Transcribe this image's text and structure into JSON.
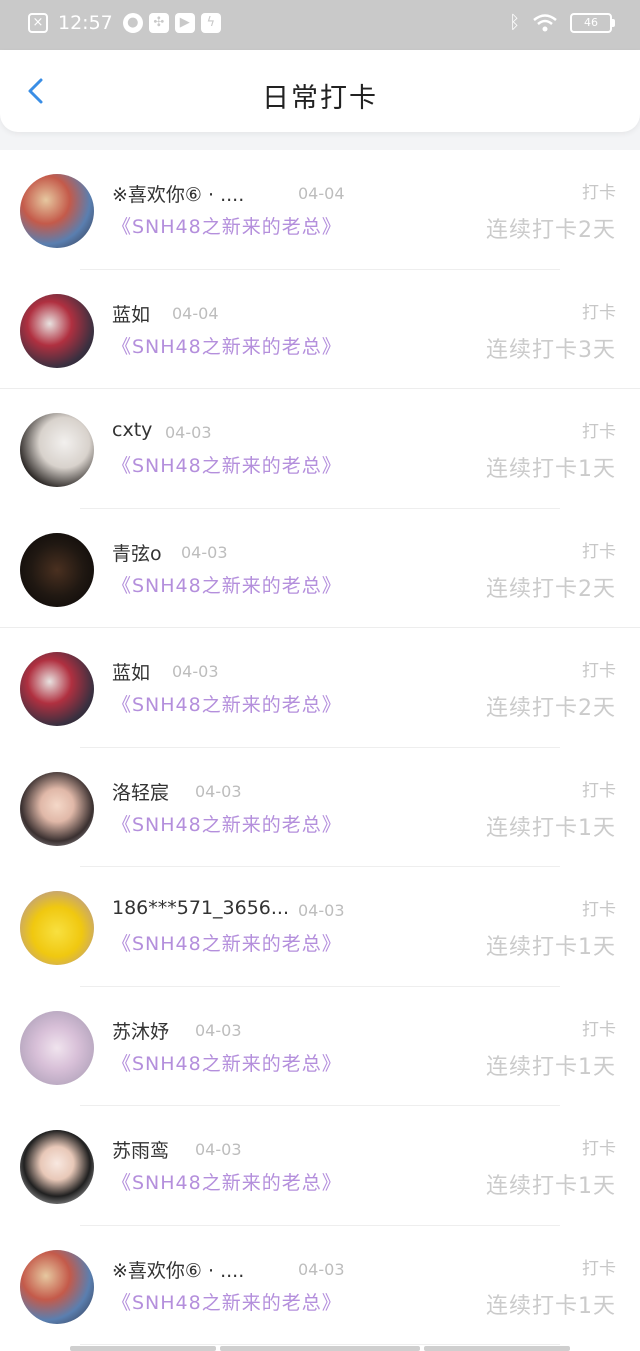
{
  "status_bar": {
    "time": "12:57",
    "battery": "46",
    "icons": [
      "close-icon",
      "cloud-icon",
      "fan-icon",
      "play-icon",
      "lightning-icon",
      "bluetooth-icon",
      "wifi-icon",
      "battery-icon"
    ]
  },
  "header": {
    "title": "日常打卡",
    "back_icon": "chevron-left-icon",
    "accent": "#3a8ee6"
  },
  "colors": {
    "book_title": "#b48fdc",
    "muted": "#c7c7c7"
  },
  "checkins": [
    {
      "name": "※喜欢你⑥ · ....",
      "date": "04-04",
      "book": "《SNH48之新来的老总》",
      "tag": "打卡",
      "streak": "连续打卡2天"
    },
    {
      "name": "蓝如",
      "date": "04-04",
      "book": "《SNH48之新来的老总》",
      "tag": "打卡",
      "streak": "连续打卡3天"
    },
    {
      "name": "cxty",
      "date": "04-03",
      "book": "《SNH48之新来的老总》",
      "tag": "打卡",
      "streak": "连续打卡1天"
    },
    {
      "name": "青弦o",
      "date": "04-03",
      "book": "《SNH48之新来的老总》",
      "tag": "打卡",
      "streak": "连续打卡2天"
    },
    {
      "name": "蓝如",
      "date": "04-03",
      "book": "《SNH48之新来的老总》",
      "tag": "打卡",
      "streak": "连续打卡2天"
    },
    {
      "name": "洛轻宸",
      "date": "04-03",
      "book": "《SNH48之新来的老总》",
      "tag": "打卡",
      "streak": "连续打卡1天"
    },
    {
      "name": "186***571_3656...",
      "date": "04-03",
      "book": "《SNH48之新来的老总》",
      "tag": "打卡",
      "streak": "连续打卡1天"
    },
    {
      "name": "苏沐妤",
      "date": "04-03",
      "book": "《SNH48之新来的老总》",
      "tag": "打卡",
      "streak": "连续打卡1天"
    },
    {
      "name": "苏雨鸾",
      "date": "04-03",
      "book": "《SNH48之新来的老总》",
      "tag": "打卡",
      "streak": "连续打卡1天"
    },
    {
      "name": "※喜欢你⑥ · ....",
      "date": "04-03",
      "book": "《SNH48之新来的老总》",
      "tag": "打卡",
      "streak": "连续打卡1天"
    }
  ]
}
